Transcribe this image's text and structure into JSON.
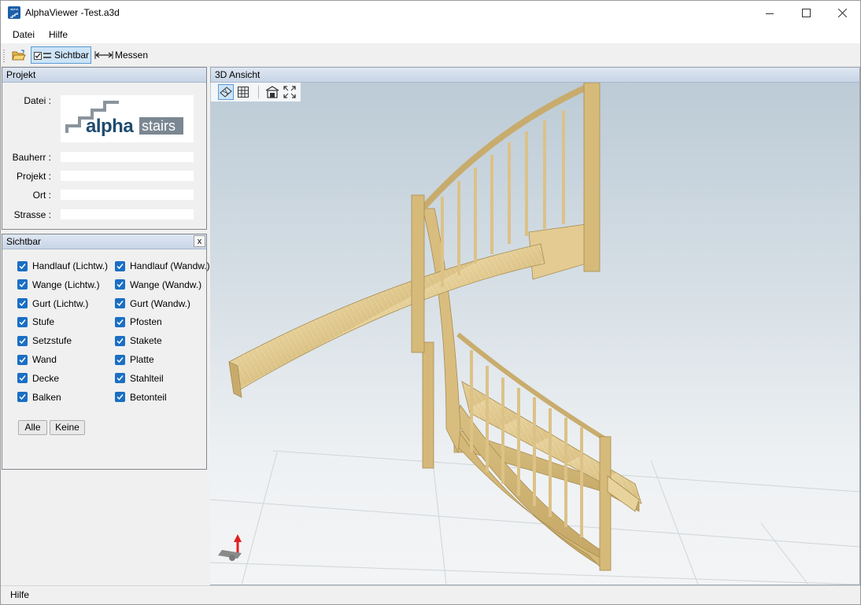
{
  "window": {
    "title": "AlphaViewer -Test.a3d",
    "app_icon_text": "alpha"
  },
  "menu": {
    "items": [
      "Datei",
      "Hilfe"
    ]
  },
  "toolbar": {
    "sichtbar_label": "Sichtbar",
    "messen_label": "Messen"
  },
  "projekt_panel": {
    "title": "Projekt",
    "fields": [
      {
        "label": "Datei",
        "value": ""
      },
      {
        "label": "Bauherr",
        "value": ""
      },
      {
        "label": "Projekt",
        "value": ""
      },
      {
        "label": "Ort",
        "value": ""
      },
      {
        "label": "Strasse",
        "value": ""
      }
    ],
    "logo": {
      "word1": "alpha",
      "word2": "stairs",
      "brand_color": "#1f4b6e",
      "accent_color": "#6f7a86"
    }
  },
  "sichtbar_panel": {
    "title": "Sichtbar",
    "close_label": "x",
    "left_items": [
      {
        "label": "Handlauf (Lichtw.)",
        "checked": true
      },
      {
        "label": "Wange (Lichtw.)",
        "checked": true
      },
      {
        "label": "Gurt (Lichtw.)",
        "checked": true
      },
      {
        "label": "Stufe",
        "checked": true
      },
      {
        "label": "Setzstufe",
        "checked": true
      },
      {
        "label": "Wand",
        "checked": true
      },
      {
        "label": "Decke",
        "checked": true
      },
      {
        "label": "Balken",
        "checked": true
      }
    ],
    "right_items": [
      {
        "label": "Handlauf (Wandw.)",
        "checked": true
      },
      {
        "label": "Wange (Wandw.)",
        "checked": true
      },
      {
        "label": "Gurt (Wandw.)",
        "checked": true
      },
      {
        "label": "Pfosten",
        "checked": true
      },
      {
        "label": "Stakete",
        "checked": true
      },
      {
        "label": "Platte",
        "checked": true
      },
      {
        "label": "Stahlteil",
        "checked": true
      },
      {
        "label": "Betonteil",
        "checked": true
      }
    ],
    "all_button": "Alle",
    "none_button": "Keine"
  },
  "view_panel": {
    "title": "3D Ansicht"
  },
  "status": {
    "text": "Hilfe"
  },
  "colors": {
    "checkbox": "#1a6fc4",
    "wood": "#e2c98f",
    "wood_dark": "#c9ab6a",
    "panel_header": "#c7d5e6"
  }
}
